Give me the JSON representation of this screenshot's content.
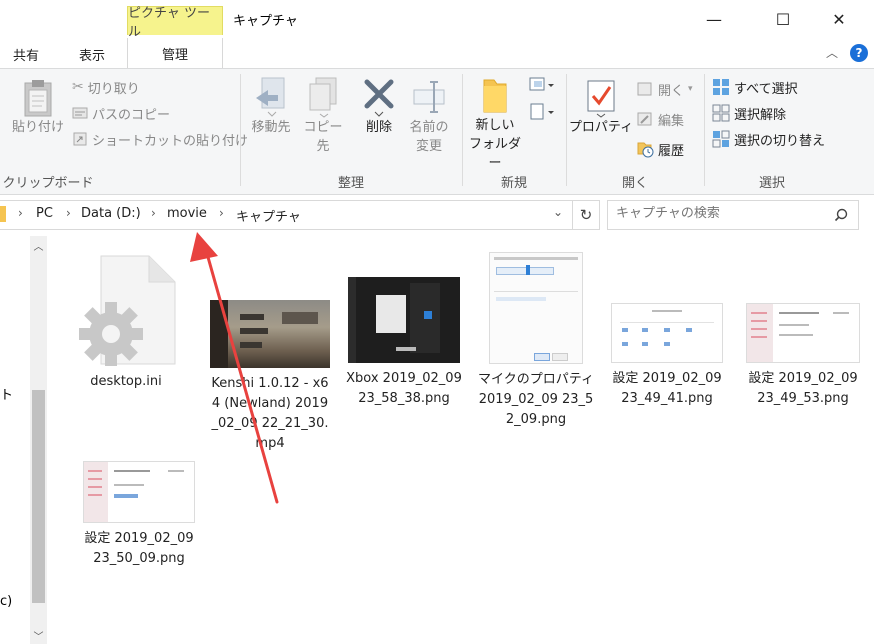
{
  "window": {
    "title": "キャプチャ",
    "context_tab": "ピクチャ ツール",
    "minimize_glyph": "—",
    "maximize_glyph": "☐",
    "close_glyph": "✕"
  },
  "tabs": {
    "share": "共有",
    "view": "表示",
    "manage": "管理",
    "help": "?"
  },
  "ribbon": {
    "clipboard": {
      "label": "クリップボード",
      "paste": "貼り付け",
      "cut": "切り取り",
      "copy_path": "パスのコピー",
      "paste_shortcut": "ショートカットの貼り付け"
    },
    "organize": {
      "label": "整理",
      "move_to": "移動先",
      "copy_to": "コピー先",
      "delete": "削除",
      "rename_line1": "名前の",
      "rename_line2": "変更"
    },
    "new": {
      "label": "新規",
      "new_folder_line1": "新しい",
      "new_folder_line2": "フォルダー"
    },
    "open": {
      "label": "開く",
      "properties": "プロパティ",
      "open": "開く",
      "edit": "編集",
      "history": "履歴"
    },
    "select": {
      "label": "選択",
      "select_all": "すべて選択",
      "select_none": "選択解除",
      "invert": "選択の切り替え"
    }
  },
  "address": {
    "crumbs": [
      "PC",
      "Data (D:)",
      "movie",
      "キャプチャ"
    ],
    "search_placeholder": "キャプチャの検索"
  },
  "nav": {
    "fragment_1": "ト",
    "fragment_2": "c)"
  },
  "files": [
    {
      "name": "desktop.ini",
      "type": "ini"
    },
    {
      "name": "Kenshi 1.0.12 - x64 (Newland) 2019_02_09 22_21_30.mp4",
      "type": "video"
    },
    {
      "name": "Xbox 2019_02_09 23_58_38.png",
      "type": "dark-shot"
    },
    {
      "name": "マイクのプロパティ 2019_02_09 23_52_09.png",
      "type": "dialog-shot"
    },
    {
      "name": "設定 2019_02_09 23_49_41.png",
      "type": "settings-shot"
    },
    {
      "name": "設定 2019_02_09 23_49_53.png",
      "type": "settings-shot"
    },
    {
      "name": "設定 2019_02_09 23_50_09.png",
      "type": "settings-shot"
    }
  ],
  "colors": {
    "accent": "#1a6fd8",
    "context_tab": "#f6f38d",
    "annotation_arrow": "#e8423f"
  }
}
